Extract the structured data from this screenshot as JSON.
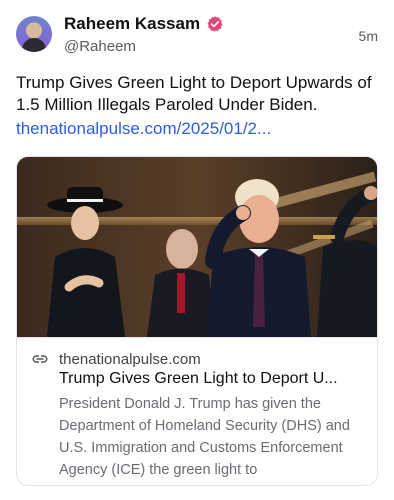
{
  "author": {
    "name": "Raheem Kassam",
    "handle": "@Raheem",
    "verified_color": "#e0457b"
  },
  "post": {
    "timestamp": "5m",
    "text": "Trump Gives Green Light to Deport Upwards of 1.5 Million Illegals Paroled Under Biden.",
    "link_text": "thenationalpulse.com/2025/01/2..."
  },
  "link_card": {
    "domain": "thenationalpulse.com",
    "title": "Trump Gives Green Light to Deport U...",
    "description": "President Donald J. Trump has given the Department of Homeland Security (DHS) and U.S. Immigration and Customs Enforcement Agency (ICE) the green light to"
  },
  "colors": {
    "link": "#2b5fd9",
    "text": "#111111",
    "muted": "#5b5b63"
  }
}
